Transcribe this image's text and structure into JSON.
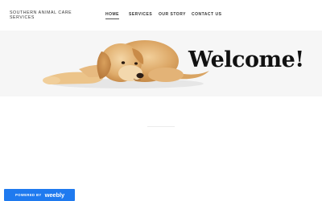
{
  "header": {
    "site_title": "SOUTHERN ANIMAL CARE SERVICES",
    "nav": [
      {
        "label": "HOME",
        "active": true
      },
      {
        "label": "SERVICES",
        "active": false
      },
      {
        "label": "OUR STORY",
        "active": false
      },
      {
        "label": "CONTACT US",
        "active": false
      }
    ]
  },
  "hero": {
    "heading": "Welcome!",
    "image": "golden-retriever-puppy-lying-down"
  },
  "footer": {
    "powered_by": "POWERED BY",
    "brand": "weebly"
  },
  "colors": {
    "hero_background": "#f6f6f6",
    "badge_background": "#1f7aef",
    "text": "#333333"
  }
}
